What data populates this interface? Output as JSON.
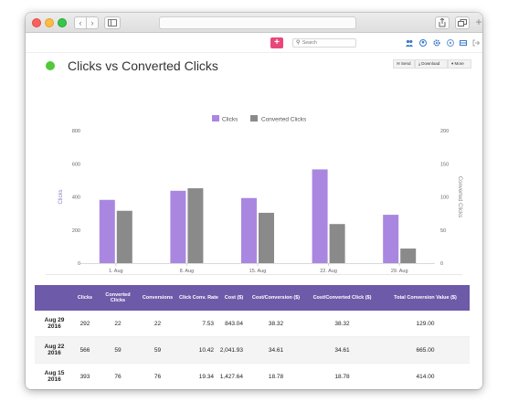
{
  "browser": {
    "nav_back": "‹",
    "nav_forward": "›",
    "new_tab": "+"
  },
  "toolbar": {
    "add_label": "+",
    "search_placeholder": "Search",
    "accent_color": "#e8477a"
  },
  "header": {
    "title": "Clicks vs Converted Clicks",
    "status_color": "#51c93a",
    "buttons": {
      "send": "✉ Send",
      "download": "⤓ Download",
      "more": "▾ More"
    }
  },
  "chart_data": {
    "type": "bar",
    "categories": [
      "1. Aug",
      "8. Aug",
      "15. Aug",
      "22. Aug",
      "29. Aug"
    ],
    "series": [
      {
        "name": "Clicks",
        "color": "#a987e0",
        "values": [
          382,
          437,
          393,
          566,
          292
        ]
      },
      {
        "name": "Converted Clicks",
        "color": "#8a8a8a",
        "values": [
          79,
          113,
          76,
          59,
          22
        ]
      }
    ],
    "ylabel": "Clicks",
    "y2label": "Converted Clicks",
    "ylim": [
      0,
      800
    ],
    "y2lim": [
      0,
      200
    ],
    "yticks": [
      "0",
      "200",
      "400",
      "600",
      "800"
    ],
    "y2ticks": [
      "0",
      "50",
      "100",
      "150",
      "200"
    ],
    "grid": false,
    "legend": "top-center"
  },
  "table": {
    "headers": [
      "",
      "Clicks",
      "Converted Clicks",
      "Conversions",
      "Click Conv. Rate",
      "Cost ($)",
      "Cost/Conversion ($)",
      "Cost/Converted Click ($)",
      "Total Conversion Value ($)"
    ],
    "rows": [
      [
        "Aug 29 2016",
        "292",
        "22",
        "22",
        "7.53",
        "843.04",
        "38.32",
        "38.32",
        "129.00"
      ],
      [
        "Aug 22 2016",
        "566",
        "59",
        "59",
        "10.42",
        "2,041.93",
        "34.61",
        "34.61",
        "665.00"
      ],
      [
        "Aug 15 2016",
        "393",
        "76",
        "76",
        "19.34",
        "1,427.64",
        "18.78",
        "18.78",
        "414.00"
      ]
    ]
  }
}
